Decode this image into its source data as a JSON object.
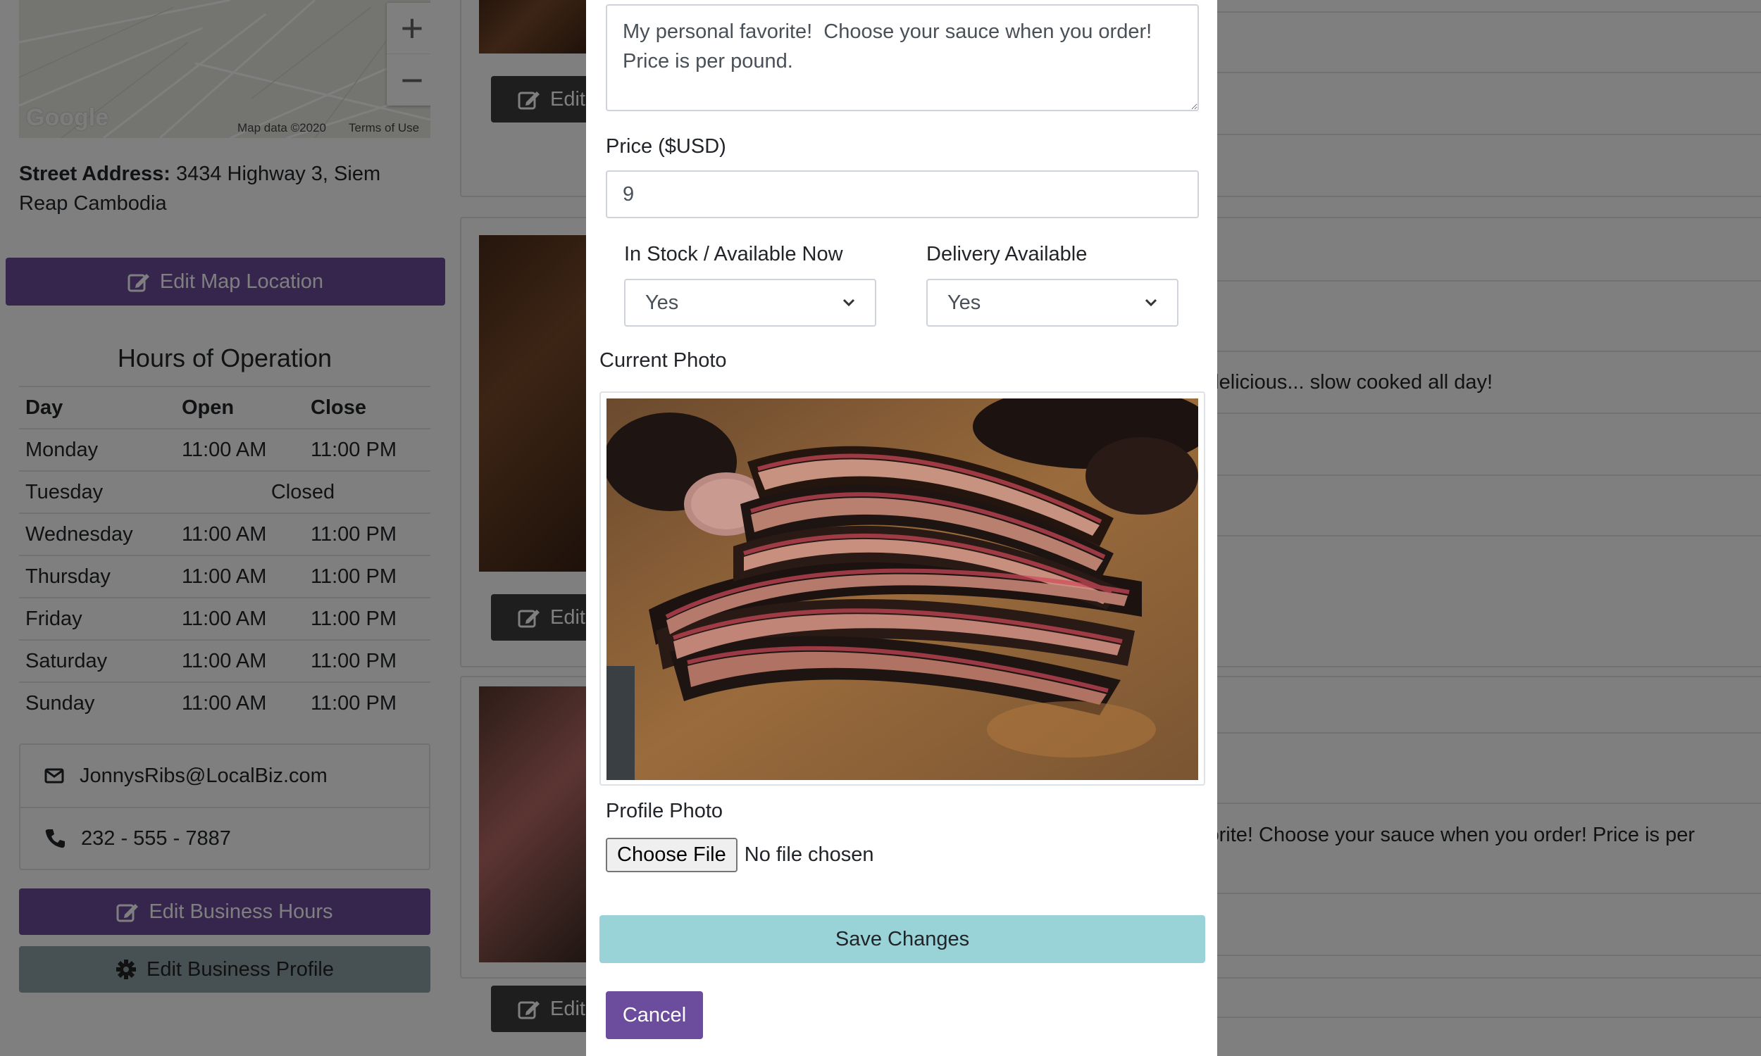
{
  "sidebar": {
    "map": {
      "zoom_in": "+",
      "zoom_out": "−",
      "logo": "Google",
      "attribution": "Map data ©2020",
      "terms": "Terms of Use"
    },
    "street_label": "Street Address:",
    "street_value": "3434 Highway 3, Siem Reap Cambodia",
    "edit_map_label": "Edit Map Location",
    "hours_title": "Hours of Operation",
    "hours_headers": [
      "Day",
      "Open",
      "Close"
    ],
    "hours": [
      {
        "day": "Monday",
        "open": "11:00 AM",
        "close": "11:00 PM"
      },
      {
        "day": "Tuesday",
        "closed": "Closed"
      },
      {
        "day": "Wednesday",
        "open": "11:00 AM",
        "close": "11:00 PM"
      },
      {
        "day": "Thursday",
        "open": "11:00 AM",
        "close": "11:00 PM"
      },
      {
        "day": "Friday",
        "open": "11:00 AM",
        "close": "11:00 PM"
      },
      {
        "day": "Saturday",
        "open": "11:00 AM",
        "close": "11:00 PM"
      },
      {
        "day": "Sunday",
        "open": "11:00 AM",
        "close": "11:00 PM"
      }
    ],
    "email": "JonnysRibs@LocalBiz.com",
    "phone": "232 - 555 - 7887",
    "edit_hours_label": "Edit Business Hours",
    "edit_profile_label": "Edit Business Profile"
  },
  "menu_list": {
    "edit_label": "Edit",
    "item_texts": [
      "l delicious... slow cooked all day!",
      "vorite! Choose your sauce when you order! Price is per"
    ]
  },
  "modal": {
    "description_value": "My personal favorite!  Choose your sauce when you order!  Price is per pound.",
    "price_label": "Price ($USD)",
    "price_value": "9",
    "in_stock_label": "In Stock / Available Now",
    "in_stock_value": "Yes",
    "delivery_label": "Delivery Available",
    "delivery_value": "Yes",
    "current_photo_label": "Current Photo",
    "profile_photo_label": "Profile Photo",
    "choose_file_label": "Choose File",
    "no_file_text": "No file chosen",
    "save_label": "Save Changes",
    "cancel_label": "Cancel"
  },
  "colors": {
    "purple": "#6c4c9c",
    "teal": "#99d3d7",
    "slate": "#8fa3a8",
    "dark_button": "#3d3d3d"
  }
}
